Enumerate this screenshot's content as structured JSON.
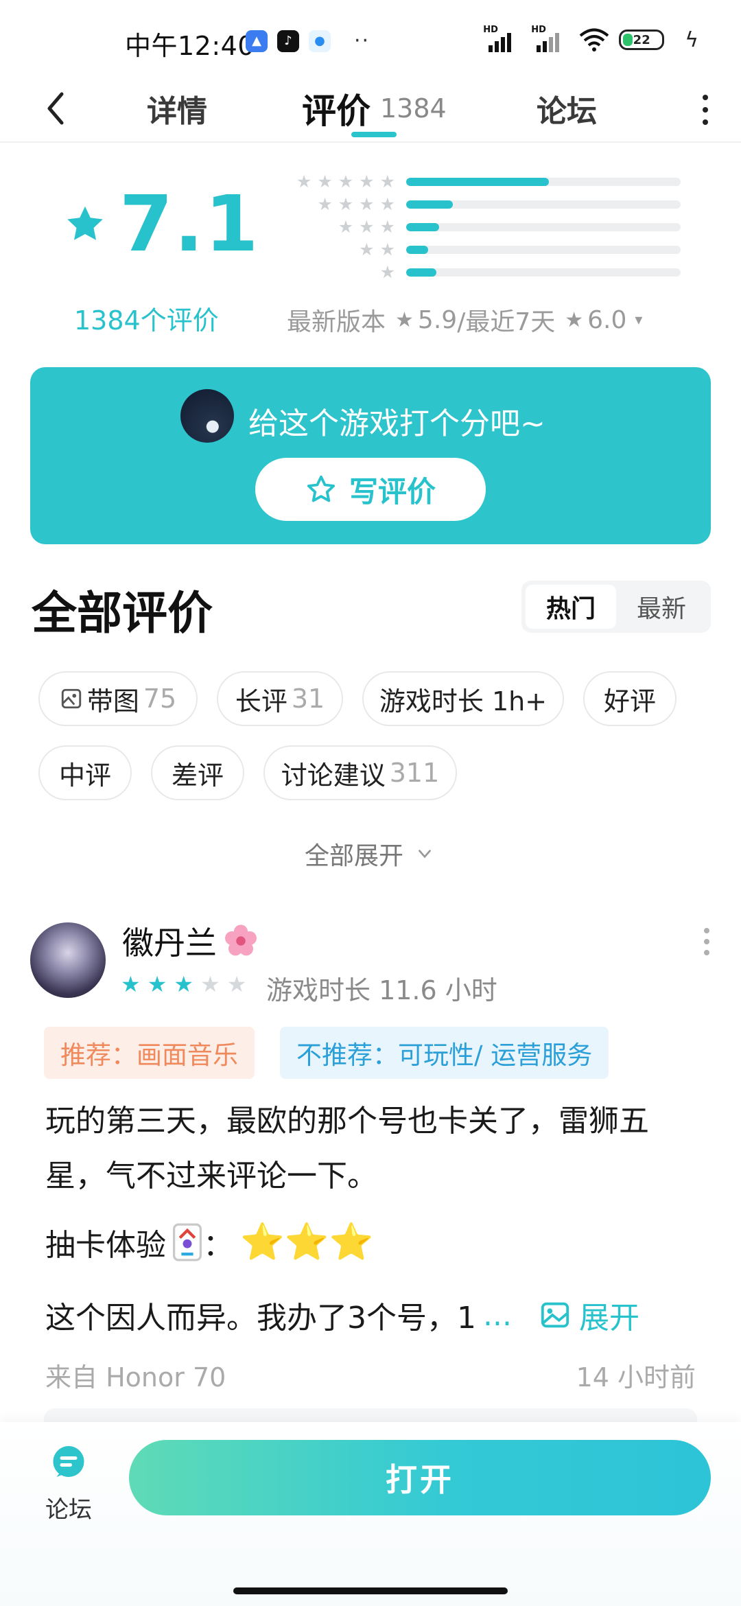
{
  "status_bar": {
    "time": "中午12:40",
    "hd1": "HD",
    "hd2": "HD",
    "battery": "22",
    "more_dots": "··"
  },
  "nav": {
    "tab_detail": "详情",
    "tab_review": "评价",
    "review_count": "1384",
    "tab_forum": "论坛"
  },
  "rating": {
    "score": "7.1",
    "count_label": "1384个评价",
    "distribution": [
      {
        "stars": 5,
        "fraction": 0.52
      },
      {
        "stars": 4,
        "fraction": 0.17
      },
      {
        "stars": 3,
        "fraction": 0.12
      },
      {
        "stars": 2,
        "fraction": 0.08
      },
      {
        "stars": 1,
        "fraction": 0.11
      }
    ],
    "latest_version_label": "最新版本",
    "latest_version_score": "5.9",
    "recent_label": "/最近7天",
    "recent_score": "6.0"
  },
  "banner": {
    "prompt": "给这个游戏打个分吧~",
    "write_label": "写评价"
  },
  "reviews_header": {
    "title": "全部评价",
    "sort_hot": "热门",
    "sort_new": "最新"
  },
  "filters": {
    "with_image": "带图",
    "with_image_count": "75",
    "long": "长评",
    "long_count": "31",
    "playtime": "游戏时长 1h+",
    "positive": "好评",
    "neutral": "中评",
    "negative": "差评",
    "discussion": "讨论建议",
    "discussion_count": "311",
    "expand_all": "全部展开"
  },
  "review": {
    "username": "徽丹兰",
    "rating": 3,
    "playtime": "游戏时长 11.6 小时",
    "recommend": "推荐：画面音乐",
    "not_recommend": "不推荐：可玩性/ 运营服务",
    "body": "玩的第三天，最欧的那个号也卡关了，雷狮五星，气不过来评论一下。",
    "gacha_label": "抽卡体验",
    "gacha_colon": "：",
    "gacha_stars": "⭐⭐⭐",
    "truncated": "这个因人而异。我办了3个号，1",
    "ellipsis": "...",
    "expand": "展开",
    "device": "来自 Honor 70",
    "time_ago": "14 小时前"
  },
  "bottom": {
    "forum_label": "论坛",
    "open_label": "打开"
  },
  "colors": {
    "accent": "#27c2cc",
    "recommend_text": "#f08a5d",
    "not_recommend_text": "#2a9fd8"
  }
}
